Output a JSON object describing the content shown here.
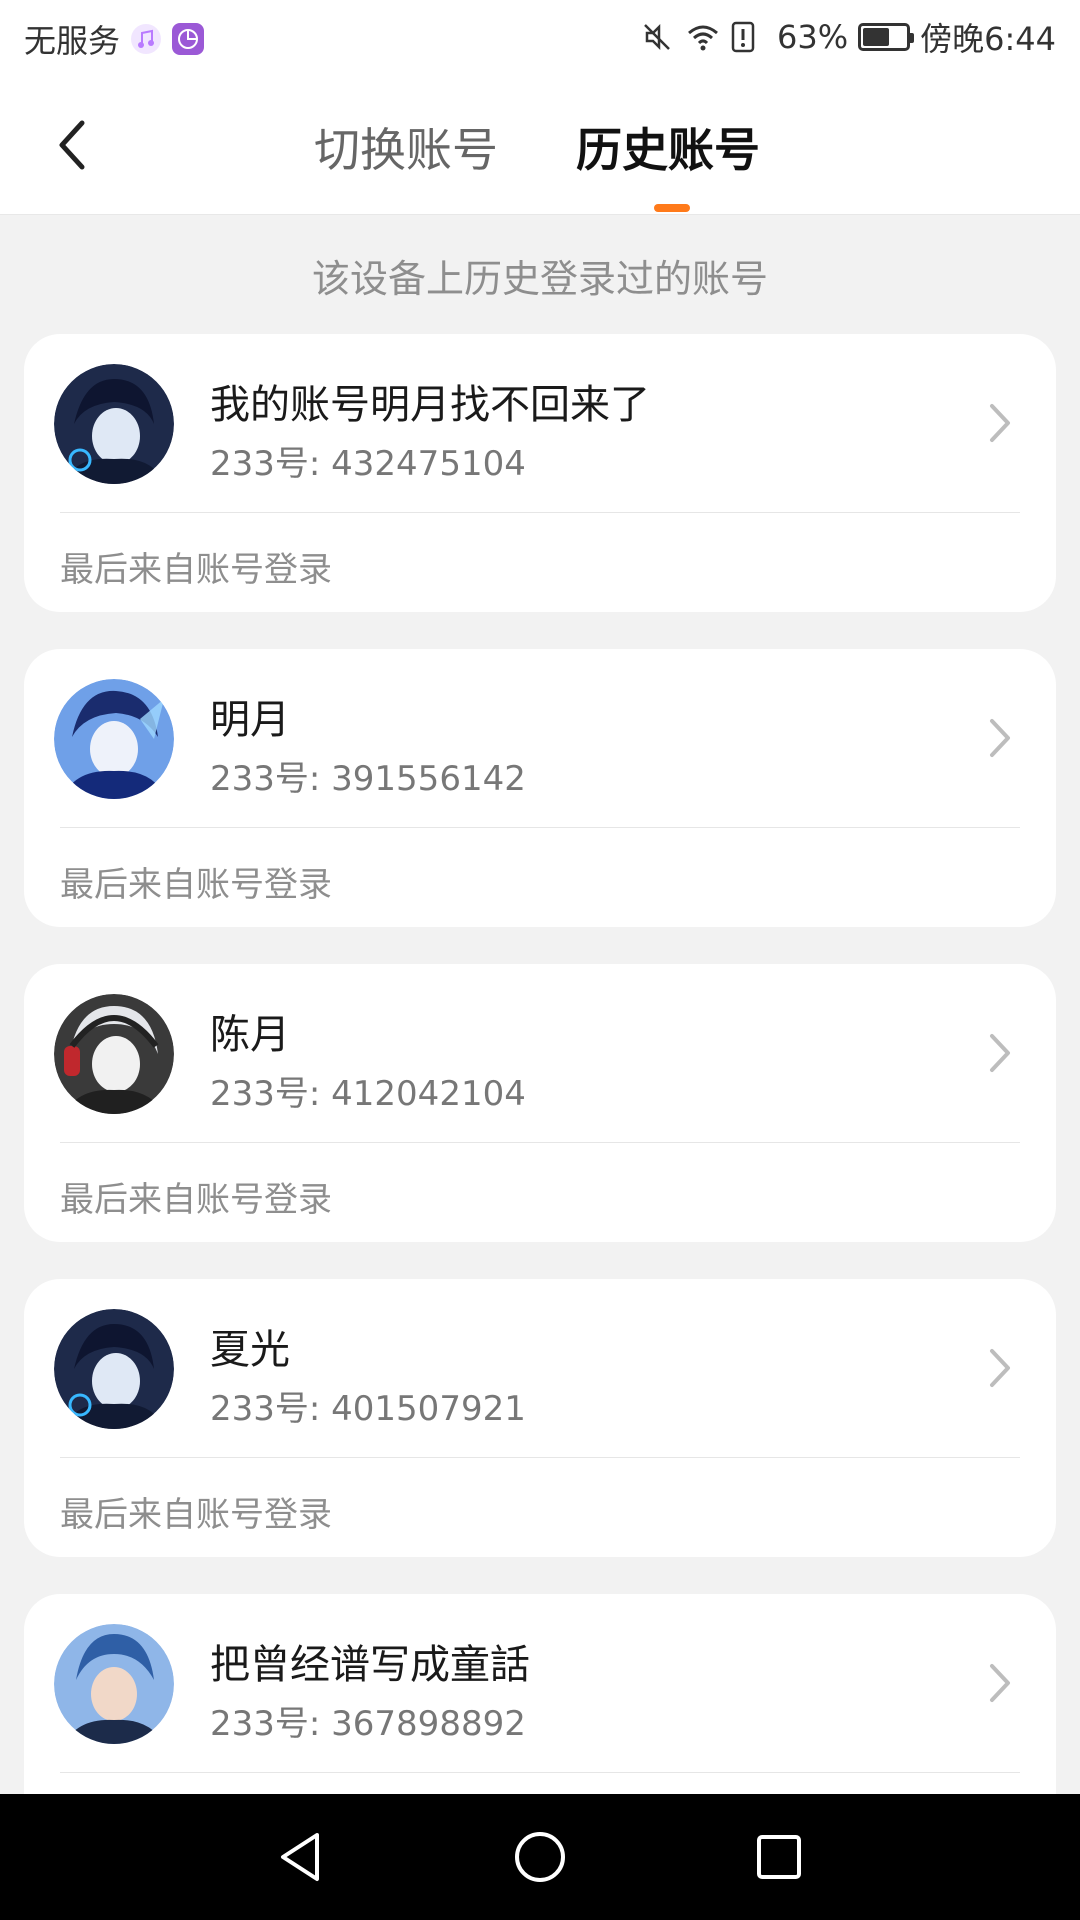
{
  "status_bar": {
    "carrier": "无服务",
    "battery_percent": "63%",
    "battery_level": 0.63,
    "time": "傍晚6:44",
    "icons": [
      "music-app-icon",
      "app-icon",
      "mute-icon",
      "wifi-icon",
      "alert-icon",
      "battery-icon"
    ]
  },
  "header": {
    "tabs": [
      {
        "label": "切换账号",
        "active": false
      },
      {
        "label": "历史账号",
        "active": true
      }
    ],
    "accent_color": "#ff7a1a"
  },
  "subtitle": "该设备上历史登录过的账号",
  "accounts": [
    {
      "name": "我的账号明月找不回来了",
      "id": "233号: 432475104",
      "footer": "最后来自账号登录",
      "avatar_color": "#1e2a4a"
    },
    {
      "name": "明月",
      "id": "233号: 391556142",
      "footer": "最后来自账号登录",
      "avatar_color": "#2a4b9a"
    },
    {
      "name": "陈月",
      "id": "233号: 412042104",
      "footer": "最后来自账号登录",
      "avatar_color": "#3a3a3a"
    },
    {
      "name": "夏光",
      "id": "233号: 401507921",
      "footer": "最后来自账号登录",
      "avatar_color": "#1e2a4a"
    },
    {
      "name": "把曾经谱写成童話",
      "id": "233号: 367898892",
      "footer": "",
      "avatar_color": "#3f6fae"
    }
  ]
}
